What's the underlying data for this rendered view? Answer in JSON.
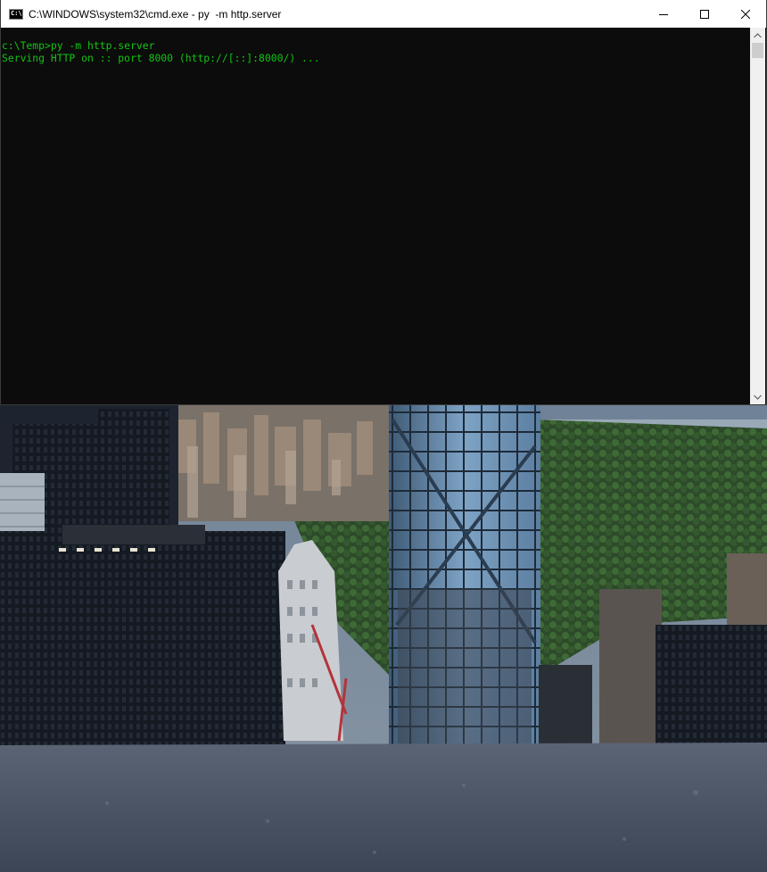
{
  "window": {
    "title": "C:\\WINDOWS\\system32\\cmd.exe - py  -m http.server",
    "icon_text": "C:\\",
    "controls": [
      "minimize-icon",
      "maximize-icon",
      "close-icon"
    ]
  },
  "console": {
    "lines": [
      "c:\\Temp>py -m http.server",
      "Serving HTTP on :: port 8000 (http://[::]:8000/) ..."
    ],
    "text_color": "#13c313",
    "background": "#0c0c0c"
  },
  "scrollbar": {
    "up_icon": "chevron-up-icon",
    "down_icon": "chevron-down-icon"
  },
  "colors": {
    "titlebar": "#ffffff",
    "console_bg": "#0c0c0c",
    "console_text": "#13c313"
  }
}
